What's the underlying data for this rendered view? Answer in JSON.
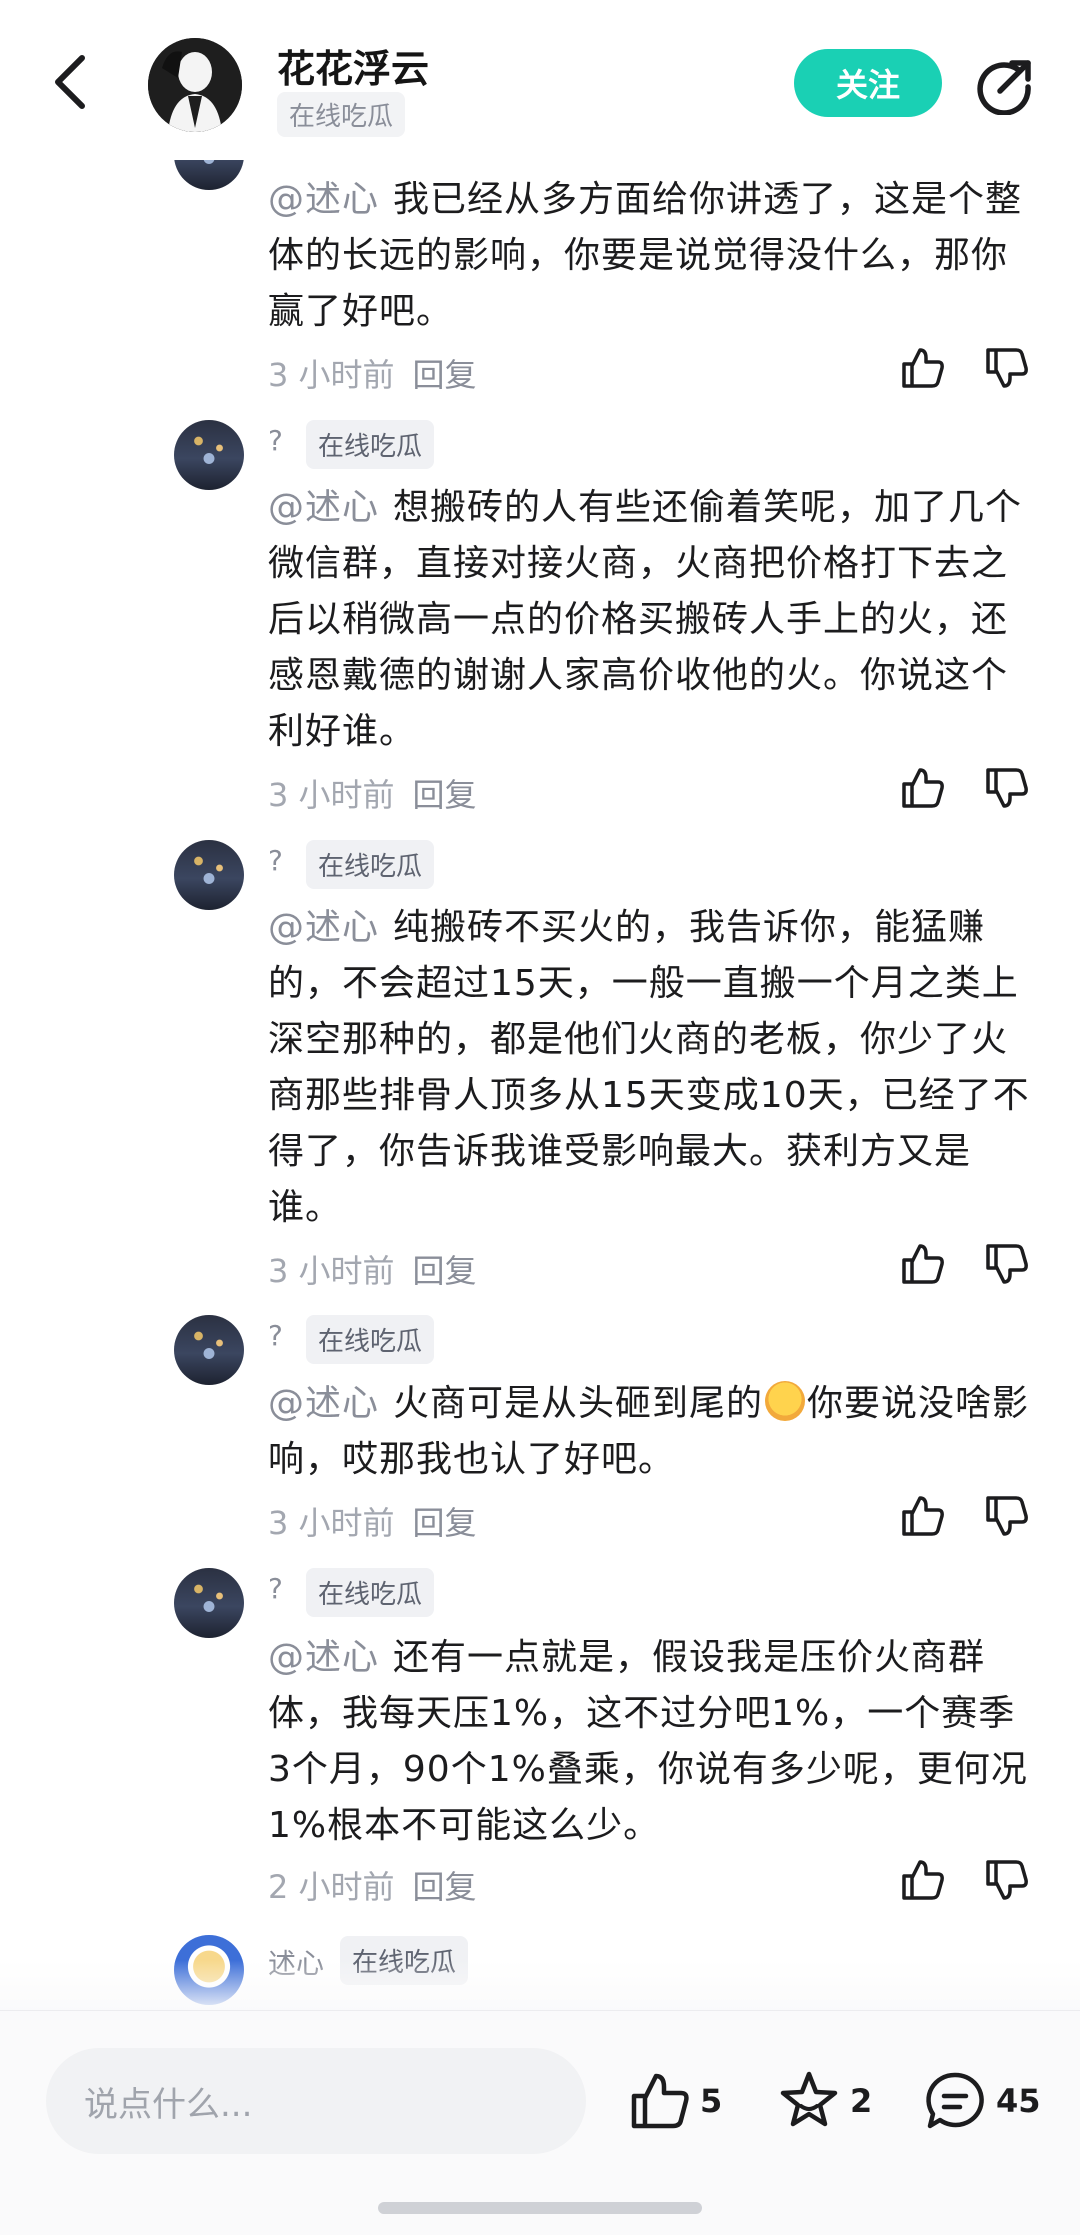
{
  "header": {
    "back_icon": "chevron-left-icon",
    "title": "花花浮云",
    "badge": "在线吃瓜",
    "follow_label": "关注",
    "share_icon": "share-icon"
  },
  "comments": [
    {
      "name": "",
      "badge": "",
      "mention": "@述心",
      "text": "我已经从多方面给你讲透了，这是个整体的长远的影响，你要是说觉得没什么，那你赢了好吧。",
      "time": "3 小时前",
      "reply": "回复"
    },
    {
      "name": "?",
      "badge": "在线吃瓜",
      "mention": "@述心",
      "text": "想搬砖的人有些还偷着笑呢，加了几个微信群，直接对接火商，火商把价格打下去之后以稍微高一点的价格买搬砖人手上的火，还感恩戴德的谢谢人家高价收他的火。你说这个利好谁。",
      "time": "3 小时前",
      "reply": "回复"
    },
    {
      "name": "?",
      "badge": "在线吃瓜",
      "mention": "@述心",
      "text": "纯搬砖不买火的，我告诉你，能猛赚的，不会超过15天，一般一直搬一个月之类上深空那种的，都是他们火商的老板，你少了火商那些排骨人顶多从15天变成10天，已经了不得了，你告诉我谁受影响最大。获利方又是谁。",
      "time": "3 小时前",
      "reply": "回复"
    },
    {
      "name": "?",
      "badge": "在线吃瓜",
      "mention": "@述心",
      "text_a": "火商可是从头砸到尾的",
      "text_b": "你要说没啥影响，哎那我也认了好吧。",
      "time": "3 小时前",
      "reply": "回复"
    },
    {
      "name": "?",
      "badge": "在线吃瓜",
      "mention": "@述心",
      "text": "还有一点就是，假设我是压价火商群体，我每天压1%，这不过分吧1%，一个赛季3个月，90个1%叠乘，你说有多少呢，更何况1%根本不可能这么少。",
      "time": "2 小时前",
      "reply": "回复"
    },
    {
      "name": "述心",
      "badge": "在线吃瓜"
    }
  ],
  "bottom": {
    "placeholder": "说点什么...",
    "likes": "5",
    "stars": "2",
    "comments": "45"
  }
}
